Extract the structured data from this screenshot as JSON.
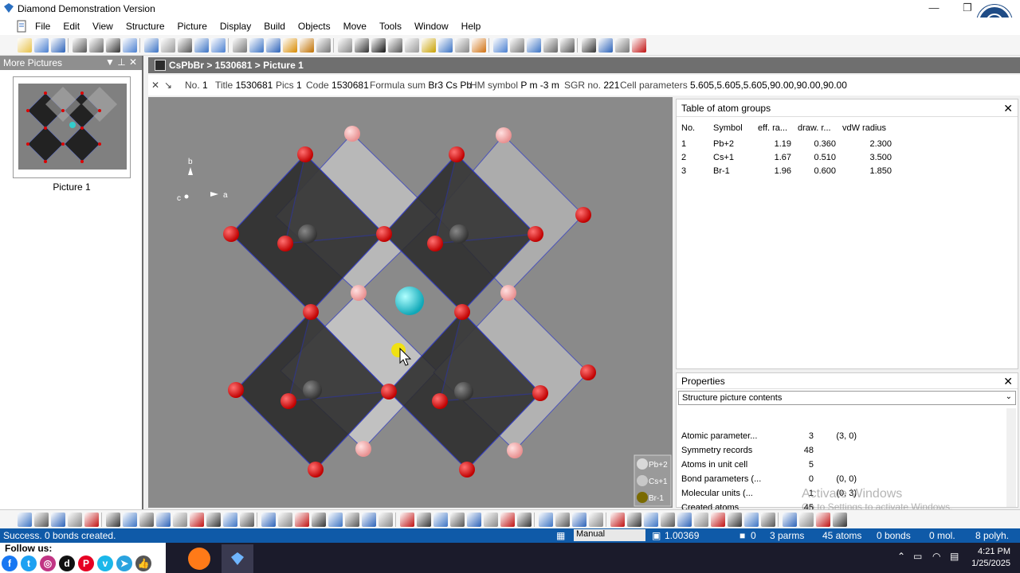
{
  "window": {
    "title": "Diamond Demonstration Version",
    "minimize_glyph": "—",
    "restore_glyph": "❐"
  },
  "menu": {
    "items": [
      "File",
      "Edit",
      "View",
      "Structure",
      "Picture",
      "Display",
      "Build",
      "Objects",
      "Move",
      "Tools",
      "Window",
      "Help"
    ]
  },
  "left_panel": {
    "title": "More Pictures",
    "pin_glyph": "▼ ⊥",
    "close_glyph": "✕",
    "thumbnail_label": "Picture 1"
  },
  "doc_tab": {
    "breadcrumb": "CsPbBr > 1530681 > Picture 1"
  },
  "infobar": {
    "no_label": "No.",
    "no_value": "1",
    "title_label": "Title",
    "title_value": "1530681",
    "pics_label": "Pics",
    "pics_value": "1",
    "code_label": "Code",
    "code_value": "1530681",
    "formula_label": "Formula sum",
    "formula_value": "Br3 Cs Pb",
    "hm_label": "HM symbol",
    "hm_value": "P m -3 m",
    "sgr_label": "SGR no.",
    "sgr_value": "221",
    "cell_label": "Cell parameters",
    "cell_value": "5.605,5.605,5.605,90.00,90.00,90.00"
  },
  "viewport": {
    "axis_b": "b",
    "axis_a": "a",
    "axis_c": "c",
    "legend": [
      {
        "symbol": "Pb+2",
        "color": "#d9d9d9"
      },
      {
        "symbol": "Cs+1",
        "color": "#c8c8c8"
      },
      {
        "symbol": "Br-1",
        "color": "#7a6a00"
      }
    ]
  },
  "atom_groups": {
    "title": "Table of atom groups",
    "close_glyph": "✕",
    "columns": [
      "No.",
      "Symbol",
      "eff. ra...",
      "draw. r...",
      "vdW radius"
    ],
    "rows": [
      [
        "1",
        "Pb+2",
        "1.19",
        "0.360",
        "2.300"
      ],
      [
        "2",
        "Cs+1",
        "1.67",
        "0.510",
        "3.500"
      ],
      [
        "3",
        "Br-1",
        "1.96",
        "0.600",
        "1.850"
      ]
    ]
  },
  "properties": {
    "title": "Properties",
    "close_glyph": "✕",
    "selected": "Structure picture contents",
    "rows": [
      [
        "Atomic parameter...",
        "3",
        "(3, 0)"
      ],
      [
        "Symmetry records",
        "48",
        ""
      ],
      [
        "Atoms in unit cell",
        "5",
        ""
      ],
      [
        "Bond parameters (...",
        "0",
        "(0, 0)"
      ],
      [
        "Molecular units (...",
        "1",
        "(0, 3)"
      ],
      [
        "Created atoms",
        "45",
        ""
      ]
    ]
  },
  "watermark": {
    "line1": "Activate Windows",
    "line2": "Go to Settings to activate Windows."
  },
  "status": {
    "message": "Success. 0 bonds created.",
    "mode": "Manual",
    "zoom": "1.00369",
    "count0": "0",
    "parms": "3 parms",
    "atoms": "45 atoms",
    "bonds": "0 bonds",
    "mol": "0 mol.",
    "polyh": "8 polyh."
  },
  "follow": {
    "label": "Follow us:",
    "networks": [
      {
        "name": "facebook",
        "glyph": "f",
        "color": "#1877f2"
      },
      {
        "name": "twitter",
        "glyph": "t",
        "color": "#1da1f2"
      },
      {
        "name": "instagram",
        "glyph": "◎",
        "color": "#c13584"
      },
      {
        "name": "dailymotion",
        "glyph": "d",
        "color": "#111111"
      },
      {
        "name": "pinterest",
        "glyph": "P",
        "color": "#e60023"
      },
      {
        "name": "vimeo",
        "glyph": "v",
        "color": "#1ab7ea"
      },
      {
        "name": "telegram",
        "glyph": "➤",
        "color": "#2aa3df"
      },
      {
        "name": "like",
        "glyph": "👍",
        "color": "#555555"
      }
    ]
  },
  "clock": {
    "time": "4:21 PM",
    "date": "1/25/2025"
  }
}
